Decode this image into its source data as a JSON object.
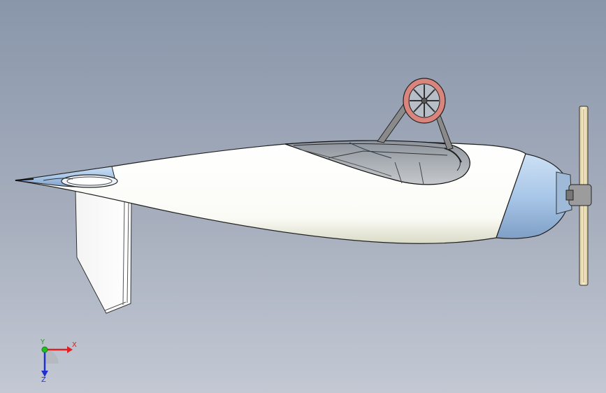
{
  "viewport": {
    "background_top": "#8996aa",
    "background_bottom": "#c3c8d3"
  },
  "model": {
    "body_color": "#ffffff",
    "nose_color": "#a9c7e8",
    "wheel_color": "#d9847c",
    "propeller_color": "#f4e6c2"
  },
  "triad": {
    "x_label": "X",
    "y_label": "Y",
    "z_label": "Z",
    "x_color": "#e02020",
    "y_color": "#20c020",
    "z_color": "#2030d0"
  }
}
